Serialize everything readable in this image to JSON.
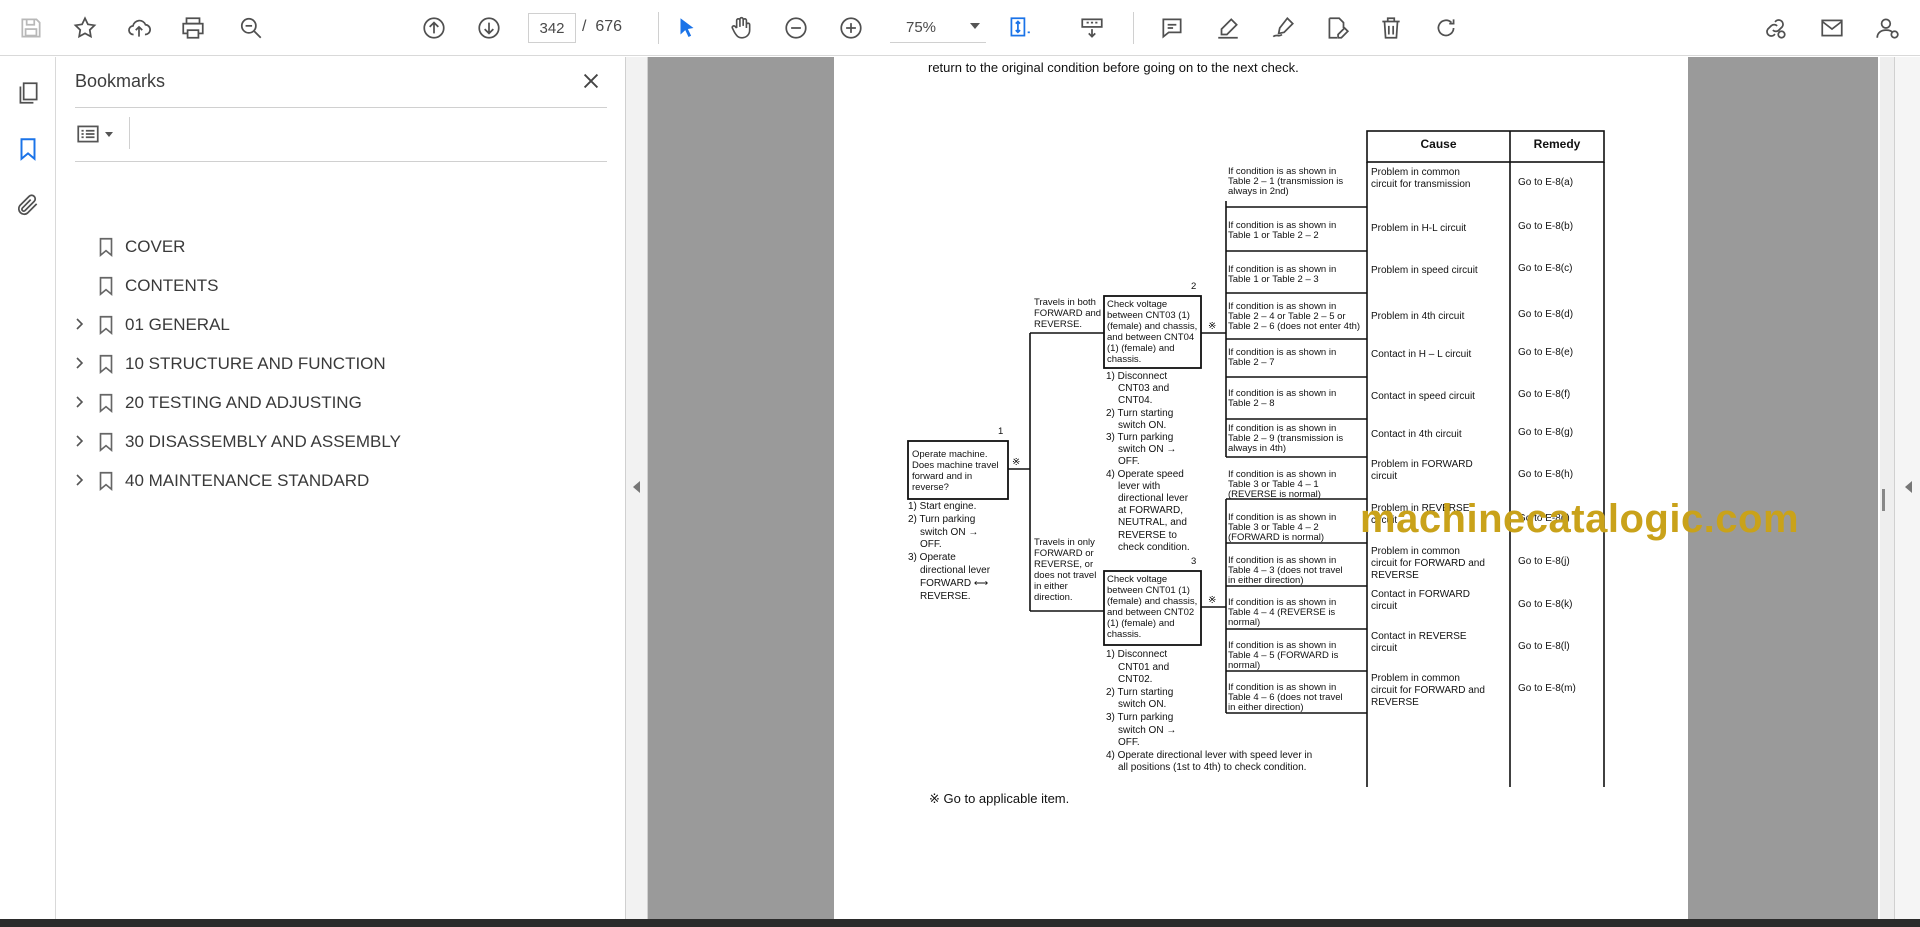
{
  "toolbar": {
    "page_current": "342",
    "page_separator": "/",
    "page_total": "676",
    "zoom": "75%"
  },
  "panel": {
    "title": "Bookmarks",
    "items": [
      {
        "label": "COVER",
        "expandable": false
      },
      {
        "label": "CONTENTS",
        "expandable": false
      },
      {
        "label": "01 GENERAL",
        "expandable": true
      },
      {
        "label": "10 STRUCTURE AND FUNCTION",
        "expandable": true
      },
      {
        "label": "20 TESTING AND ADJUSTING",
        "expandable": true
      },
      {
        "label": "30 DISASSEMBLY AND ASSEMBLY",
        "expandable": true
      },
      {
        "label": "40 MAINTENANCE STANDARD",
        "expandable": true
      }
    ]
  },
  "document": {
    "top_line": "return to the original condition before going on to the next check.",
    "header_cause": "Cause",
    "header_remedy": "Remedy",
    "step1_num": "1",
    "step1_box": "Operate machine. Does machine travel forward and in reverse?",
    "step1_list": [
      "1) Start engine.",
      "2) Turn parking",
      "switch ON →",
      "OFF.",
      "3) Operate",
      "directional lever",
      "FORWARD ⟷",
      "REVERSE."
    ],
    "branch_both": "Travels in both FORWARD and REVERSE.",
    "branch_only": "Travels in only FORWARD or REVERSE, or does not travel in either direction.",
    "step2_num": "2",
    "step2_box": "Check voltage between CNT03 (1) (female) and chassis, and between CNT04 (1) (female) and chassis.",
    "step2_list": [
      "1) Disconnect",
      "CNT03 and",
      "CNT04.",
      "2) Turn starting",
      "switch ON.",
      "3) Turn parking",
      "switch ON →",
      "OFF.",
      "4) Operate speed",
      "lever with",
      "directional lever",
      "at FORWARD,",
      "NEUTRAL, and",
      "REVERSE to",
      "check condition."
    ],
    "step3_num": "3",
    "step3_box": "Check voltage between CNT01 (1) (female) and chassis, and between CNT02 (1) (female) and chassis.",
    "step3_list": [
      "1) Disconnect",
      "CNT01 and",
      "CNT02.",
      "2) Turn starting",
      "switch ON.",
      "3) Turn parking",
      "switch ON →",
      "OFF.",
      "4) Operate directional lever with speed lever in",
      "all positions (1st to 4th) to check condition."
    ],
    "mark": "※",
    "footnote": "※   Go to applicable item.",
    "watermark": "machinecatalogic.com",
    "rows": [
      {
        "cond": [
          "If condition is as shown in",
          "Table 2 – 1 (transmission is",
          "always in 2nd)"
        ],
        "cause": [
          "Problem in common",
          "circuit for transmission"
        ],
        "remedy": "Go to E-8(a)"
      },
      {
        "cond": [
          "If condition is as shown in",
          "Table 1 or Table 2 – 2"
        ],
        "cause": [
          "Problem in H-L circuit"
        ],
        "remedy": "Go to E-8(b)"
      },
      {
        "cond": [
          "If condition is as shown in",
          "Table 1 or Table 2 – 3"
        ],
        "cause": [
          "Problem in speed circuit"
        ],
        "remedy": "Go to E-8(c)"
      },
      {
        "cond": [
          "If condition is as shown in",
          "Table 2 – 4 or Table 2 – 5 or",
          "Table 2 – 6 (does not enter 4th)"
        ],
        "cause": [
          "Problem in 4th circuit"
        ],
        "remedy": "Go to E-8(d)"
      },
      {
        "cond": [
          "If condition is as shown in",
          "Table 2 – 7"
        ],
        "cause": [
          "Contact in H – L circuit"
        ],
        "remedy": "Go to E-8(e)"
      },
      {
        "cond": [
          "If condition is as shown in",
          "Table 2 – 8"
        ],
        "cause": [
          "Contact in speed circuit"
        ],
        "remedy": "Go to E-8(f)"
      },
      {
        "cond": [
          "If condition is as shown in",
          "Table 2 – 9 (transmission is",
          "always in 4th)"
        ],
        "cause": [
          "Contact in 4th circuit"
        ],
        "remedy": "Go to E-8(g)"
      },
      {
        "cond": [
          "If condition is as shown in",
          "Table 3 or Table 4 – 1",
          "(REVERSE is normal)"
        ],
        "cause": [
          "Problem in FORWARD",
          "circuit"
        ],
        "remedy": "Go to E-8(h)"
      },
      {
        "cond": [
          "If condition is as shown in",
          "Table 3 or Table 4 – 2",
          "(FORWARD is normal)"
        ],
        "cause": [
          "Problem in REVERSE",
          "circuit"
        ],
        "remedy": "Go to E-8(i)"
      },
      {
        "cond": [
          "If condition is as shown in",
          "Table 4 – 3 (does not travel",
          "in either direction)"
        ],
        "cause": [
          "Problem in common",
          "circuit for FORWARD and",
          "REVERSE"
        ],
        "remedy": "Go to E-8(j)"
      },
      {
        "cond": [
          "If condition is as shown in",
          "Table 4 – 4 (REVERSE is",
          "normal)"
        ],
        "cause": [
          "Contact in FORWARD",
          "circuit"
        ],
        "remedy": "Go to E-8(k)"
      },
      {
        "cond": [
          "If condition is as shown in",
          "Table 4 – 5 (FORWARD is",
          "normal)"
        ],
        "cause": [
          "Contact in REVERSE",
          "circuit"
        ],
        "remedy": "Go to E-8(l)"
      },
      {
        "cond": [
          "If condition is as shown in",
          "Table 4 – 6 (does not travel",
          "in either direction)"
        ],
        "cause": [
          "Problem in common",
          "circuit for FORWARD and",
          "REVERSE"
        ],
        "remedy": "Go to E-8(m)"
      }
    ]
  },
  "colors": {
    "watermark": "#c9a21a",
    "viewer_bg": "#9a9a9a",
    "accent_blue": "#1a73e8"
  }
}
